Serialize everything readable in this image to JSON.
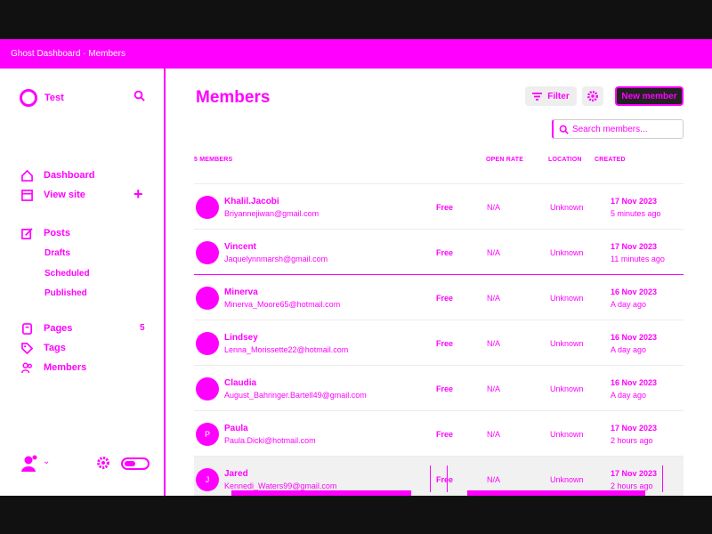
{
  "banner": {
    "text": "Ghost Dashboard · Members"
  },
  "sidebar": {
    "site_name": "Test",
    "nav": {
      "dashboard": "Dashboard",
      "view_site": "View site",
      "posts": "Posts",
      "drafts": "Drafts",
      "scheduled": "Scheduled",
      "published": "Published",
      "pages": "Pages",
      "tags": "Tags",
      "members": "Members",
      "members_count": "5"
    }
  },
  "header": {
    "title": "Members",
    "filter_label": "Filter",
    "new_member_label": "New member",
    "search_placeholder": "Search members..."
  },
  "table": {
    "columns": {
      "members": "5 MEMBERS",
      "open_rate": "OPEN RATE",
      "location": "LOCATION",
      "created": "CREATED"
    },
    "rows": [
      {
        "initials": "",
        "name": "Khalil.Jacobi",
        "email": "Briyannejiwan@gmail.com",
        "status": "Free",
        "open_rate": "N/A",
        "location": "Unknown",
        "created_date": "17 Nov 2023",
        "created_ago": "5 minutes ago"
      },
      {
        "initials": "",
        "name": "Vincent",
        "email": "Jaquelynnmarsh@gmail.com",
        "status": "Free",
        "open_rate": "N/A",
        "location": "Unknown",
        "created_date": "17 Nov 2023",
        "created_ago": "11 minutes ago"
      },
      {
        "initials": "",
        "name": "Minerva",
        "email": "Minerva_Moore65@hotmail.com",
        "status": "Free",
        "open_rate": "N/A",
        "location": "Unknown",
        "created_date": "16 Nov 2023",
        "created_ago": "A day ago"
      },
      {
        "initials": "",
        "name": "Lindsey",
        "email": "Lenna_Morissette22@hotmail.com",
        "status": "Free",
        "open_rate": "N/A",
        "location": "Unknown",
        "created_date": "16 Nov 2023",
        "created_ago": "A day ago"
      },
      {
        "initials": "",
        "name": "Claudia",
        "email": "August_Bahringer.Bartell49@gmail.com",
        "status": "Free",
        "open_rate": "N/A",
        "location": "Unknown",
        "created_date": "16 Nov 2023",
        "created_ago": "A day ago"
      },
      {
        "initials": "P",
        "name": "Paula",
        "email": "Paula.Dicki@hotmail.com",
        "status": "Free",
        "open_rate": "N/A",
        "location": "Unknown",
        "created_date": "17 Nov 2023",
        "created_ago": "2 hours ago"
      },
      {
        "initials": "J",
        "name": "Jared",
        "email": "Kennedi_Waters99@gmail.com",
        "status": "Free",
        "open_rate": "N/A",
        "location": "Unknown",
        "created_date": "17 Nov 2023",
        "created_ago": "2 hours ago"
      }
    ]
  },
  "colors": {
    "accent": "#ff00ff",
    "frame_bg": "#111111",
    "dark_button": "#222222"
  }
}
